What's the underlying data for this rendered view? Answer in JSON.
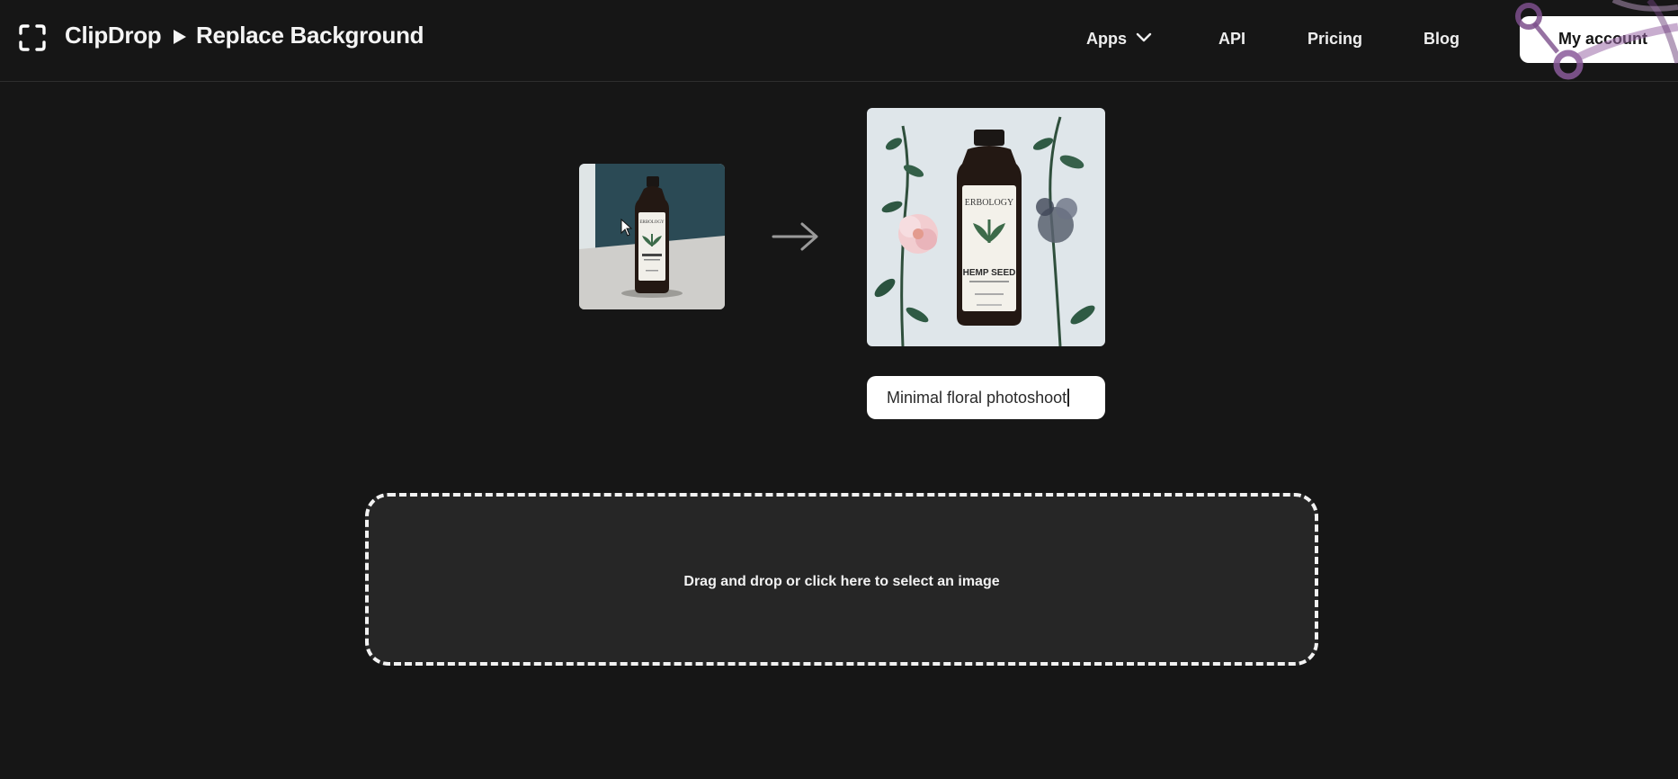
{
  "header": {
    "brand": "ClipDrop",
    "breadcrumb": "Replace Background",
    "nav": {
      "apps": "Apps",
      "api": "API",
      "pricing": "Pricing",
      "blog": "Blog"
    },
    "account_label": "My account"
  },
  "demo": {
    "product_brand": "ERBOLOGY",
    "product_name": "HEMP SEED",
    "prompt_text": "Minimal floral photoshoot"
  },
  "dropzone": {
    "label": "Drag and drop or click here to select an image"
  },
  "icons": {
    "logo": "clipdrop-logo-icon",
    "apps_dropdown": "chevron-down-icon",
    "transform_arrow": "arrow-right-icon",
    "pointer": "mouse-cursor-icon"
  },
  "colors": {
    "background": "#161616",
    "dropzone_bg": "#262626",
    "accent_purple": "#8a5a9a"
  }
}
